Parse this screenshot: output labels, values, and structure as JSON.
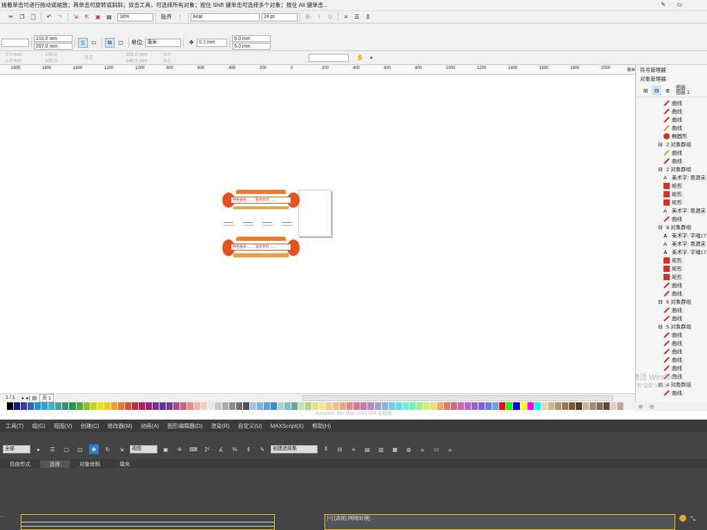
{
  "statusbar": {
    "hint": "接着单击可进行拖动或缩放；再单击可旋转或斜斜；双击工具，可选择所有对象；按住 Shift 键单击可选择多个对象；按住 Alt 键单击..."
  },
  "toolbar": {
    "zoom": "18%",
    "snap_label": "贴齐",
    "font": "Arial",
    "font_size": "24 pt"
  },
  "propbar": {
    "width": "210.0 mm",
    "height": "297.0 mm",
    "unit_label": "单位:",
    "unit": "毫米",
    "nudge": "0.1 mm",
    "dup_x": "5.0 mm",
    "dup_y": "5.0 mm"
  },
  "propbar2": {
    "x1": "0.0 mm",
    "y1": "0.0 mm",
    "sx": "100.0",
    "sy": "100.0",
    "rot": "0.0",
    "cx": "105.0 mm",
    "cy": "148.5 mm",
    "px": "0.0",
    "py": "0.0"
  },
  "ruler_labels": [
    "1800",
    "1600",
    "1400",
    "1200",
    "1000",
    "800",
    "600",
    "400",
    "200",
    "0",
    "200",
    "400",
    "600",
    "800",
    "1000",
    "1200",
    "1400",
    "1600",
    "1800",
    "2000"
  ],
  "ruler_unit": "毫米",
  "design": {
    "banner1": "特色金秋 …… 喜庆农村 ……",
    "banner2": "特色金秋 …… 喜庆农村 ……"
  },
  "page_nav": {
    "counter": "1 / 1",
    "tab": "页 1"
  },
  "docker": {
    "title1": "符号管理器",
    "title2": "对象管理器",
    "layer_label": "图层:",
    "layer_name": "图层 1",
    "items": [
      {
        "indent": 1,
        "type": "curve",
        "label": "曲线"
      },
      {
        "indent": 1,
        "type": "curve",
        "label": "曲线"
      },
      {
        "indent": 1,
        "type": "curve",
        "label": "曲线"
      },
      {
        "indent": 1,
        "type": "curve-y",
        "label": "曲线"
      },
      {
        "indent": 1,
        "type": "ellipse",
        "label": "椭圆形"
      },
      {
        "indent": 0,
        "type": "group",
        "label": "2 对象群组"
      },
      {
        "indent": 1,
        "type": "curve-y",
        "label": "曲线"
      },
      {
        "indent": 1,
        "type": "curve",
        "label": "曲线"
      },
      {
        "indent": 0,
        "type": "group",
        "label": "2 对象群组"
      },
      {
        "indent": 1,
        "type": "text",
        "label": "美术字:  思源宋"
      },
      {
        "indent": 1,
        "type": "rect",
        "label": "矩形"
      },
      {
        "indent": 1,
        "type": "rect",
        "label": "矩形"
      },
      {
        "indent": 1,
        "type": "rect",
        "label": "矩形"
      },
      {
        "indent": 1,
        "type": "text",
        "label": "美术字:  思源宋"
      },
      {
        "indent": 1,
        "type": "curve",
        "label": "曲线"
      },
      {
        "indent": 0,
        "type": "group",
        "label": "8 对象群组"
      },
      {
        "indent": 1,
        "type": "textb",
        "label": "美术字:  字魂17"
      },
      {
        "indent": 1,
        "type": "text",
        "label": "美术字:  思源宋"
      },
      {
        "indent": 1,
        "type": "textb",
        "label": "美术字:  字魂17"
      },
      {
        "indent": 1,
        "type": "rect",
        "label": "矩形"
      },
      {
        "indent": 1,
        "type": "rect",
        "label": "矩形"
      },
      {
        "indent": 1,
        "type": "rect",
        "label": "矩形"
      },
      {
        "indent": 1,
        "type": "curve",
        "label": "曲线"
      },
      {
        "indent": 1,
        "type": "curve",
        "label": "曲线"
      },
      {
        "indent": 0,
        "type": "group",
        "label": "6 对象群组"
      },
      {
        "indent": 1,
        "type": "curve",
        "label": "曲线"
      },
      {
        "indent": 1,
        "type": "curve",
        "label": "曲线"
      },
      {
        "indent": 0,
        "type": "group",
        "label": "5 对象群组"
      },
      {
        "indent": 1,
        "type": "curve",
        "label": "曲线"
      },
      {
        "indent": 1,
        "type": "curve",
        "label": "曲线"
      },
      {
        "indent": 1,
        "type": "curve",
        "label": "曲线"
      },
      {
        "indent": 1,
        "type": "curve",
        "label": "曲线"
      },
      {
        "indent": 1,
        "type": "curve",
        "label": "曲线"
      },
      {
        "indent": 1,
        "type": "curve",
        "label": "曲线"
      },
      {
        "indent": 0,
        "type": "group",
        "label": "4 对象群组"
      },
      {
        "indent": 1,
        "type": "curve",
        "label": "曲线"
      }
    ],
    "activate1": "激活 Windows",
    "activate2": "转到\"设置\"以激活 Windows"
  },
  "palette": [
    "#ffffff",
    "#000000",
    "#1a1a80",
    "#3c3c96",
    "#2d63b4",
    "#1e90d2",
    "#28a0dc",
    "#3cb4c8",
    "#46a0a0",
    "#3c8c6e",
    "#289650",
    "#50aa3c",
    "#8cbe32",
    "#c8d21e",
    "#f0e614",
    "#f0c81e",
    "#f0a028",
    "#e67832",
    "#d2503c",
    "#c8283c",
    "#b41e50",
    "#a01e78",
    "#822896",
    "#6432a0",
    "#783c8c",
    "#a05082",
    "#c86478",
    "#e68c8c",
    "#f0b4aa",
    "#f0d2be",
    "#e6e6e6",
    "#c8c8c8",
    "#aaaaaa",
    "#8c8c8c",
    "#6e6e6e",
    "#505050",
    "#a0c8e6",
    "#78b4dc",
    "#5aa0d2",
    "#3c8cc8",
    "#aad2c8",
    "#82beb4",
    "#64aaa0",
    "#c8e6aa",
    "#b4d28c",
    "#dce68c",
    "#f0e6a0",
    "#f0d28c",
    "#f0be8c",
    "#e6aa8c",
    "#dc8c8c",
    "#d27896",
    "#c878aa",
    "#b48cbe",
    "#a0a0d2",
    "#8cb4e6",
    "#78c8f0",
    "#64dcf0",
    "#64f0dc",
    "#78f0b4",
    "#a0f08c",
    "#d2f078",
    "#f0dc78",
    "#f0aa64",
    "#e67864",
    "#dc6478",
    "#d264a0",
    "#be64c8",
    "#9664d2",
    "#7864dc",
    "#6478e6",
    "#64a0f0",
    "#ff0000",
    "#00ff00",
    "#0000ff",
    "#ffff00",
    "#ff00ff",
    "#00ffff",
    "#e6d2b4",
    "#d2b48c",
    "#b49664",
    "#96784b",
    "#785a32",
    "#5a3c1e",
    "#c8b4a0",
    "#a08c78",
    "#7d6e5a",
    "#5a4b3c",
    "#e6c8c8",
    "#c8a0a0"
  ],
  "max_menu": [
    "工具(T)",
    "组(G)",
    "视图(V)",
    "创建(C)",
    "修改器(M)",
    "动画(A)",
    "图形编辑器(D)",
    "渲染(R)",
    "自定义(U)",
    "MAXScript(X)",
    "帮助(H)"
  ],
  "max_toolbar": {
    "filter": "全部",
    "coord": "视图",
    "selset": "创建选择集"
  },
  "max_ribbon_tabs": [
    "自由形式",
    "选择",
    "对象绘制",
    "填充"
  ],
  "max_viewport_label": "[+] [透视] [明暗处理]",
  "max_title_faint": "Autodesk 3ds Max 2014 x64    无标题"
}
